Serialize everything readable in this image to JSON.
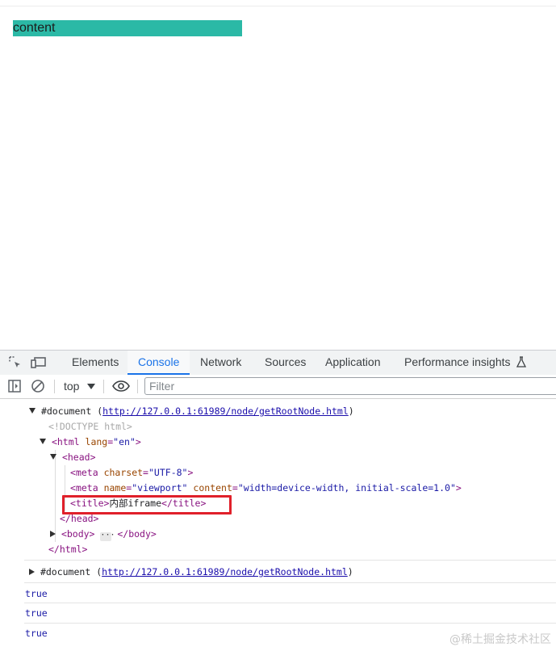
{
  "page": {
    "box_text": "content",
    "box_color": "#2bb9a6"
  },
  "devtools": {
    "tabs": [
      "Elements",
      "Console",
      "Network",
      "Sources",
      "Application",
      "Performance insights"
    ],
    "active_tab": "Console",
    "toolbar": {
      "context": "top",
      "filter_placeholder": "Filter"
    },
    "console": {
      "entry1": {
        "label": "#document",
        "url": "http://127.0.0.1:61989/node/getRootNode.html",
        "doctype": "<!DOCTYPE html>",
        "html_open_tag": "html",
        "html_lang_attr": "lang",
        "html_lang_val": "en",
        "head_tag": "head",
        "meta1": {
          "tag": "meta",
          "attr": "charset",
          "val": "UTF-8"
        },
        "meta2": {
          "tag": "meta",
          "attr1": "name",
          "val1": "viewport",
          "attr2": "content",
          "val2": "width=device-width, initial-scale=1.0"
        },
        "title_open": "<title>",
        "title_text": "内部iframe",
        "title_close": "</title>",
        "head_close": "</head>",
        "body_open": "<body>",
        "body_close": "</body>",
        "html_close": "</html>"
      },
      "entry2": {
        "label": "#document",
        "url": "http://127.0.0.1:61989/node/getRootNode.html"
      },
      "results": [
        "true",
        "true",
        "true"
      ]
    }
  },
  "watermark": "@稀土掘金技术社区"
}
